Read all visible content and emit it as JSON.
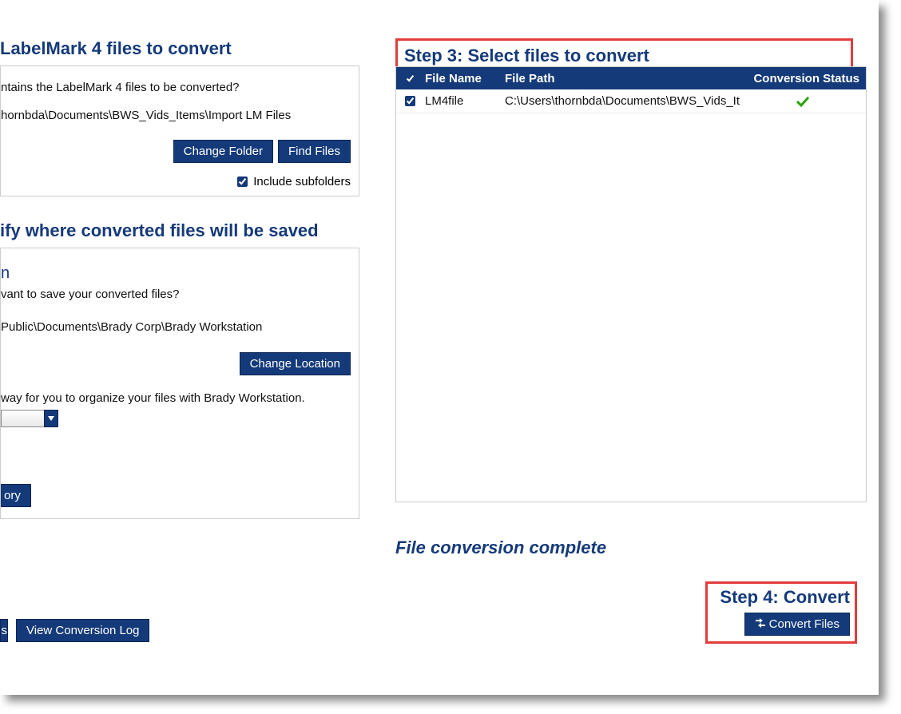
{
  "step1": {
    "title": "LabelMark 4 files to convert",
    "question": "ntains the LabelMark 4 files to be converted?",
    "path": "hornbda\\Documents\\BWS_Vids_Items\\Import LM Files",
    "change_folder_label": "Change Folder",
    "find_files_label": "Find Files",
    "include_subfolders_label": "Include subfolders"
  },
  "step2": {
    "title": "ify where converted files will be saved",
    "subheading": "n",
    "question": "vant to save your converted files?",
    "path": "Public\\Documents\\Brady Corp\\Brady Workstation",
    "change_location_label": "Change Location",
    "organize_text": "way for you to organize your files with Brady Workstation.",
    "ory_button_label": "ory"
  },
  "bottom_left": {
    "fragment_s": "s",
    "view_log_label": "View Conversion Log"
  },
  "step3": {
    "title": "Step 3: Select files to convert",
    "headers": {
      "filename": "File Name",
      "filepath": "File Path",
      "status": "Conversion Status"
    },
    "rows": [
      {
        "filename": "LM4file",
        "filepath": "C:\\Users\\thornbda\\Documents\\BWS_Vids_It",
        "status": "ok"
      }
    ]
  },
  "complete_message": "File conversion complete",
  "step4": {
    "title": "Step 4: Convert",
    "convert_label": "Convert Files"
  }
}
